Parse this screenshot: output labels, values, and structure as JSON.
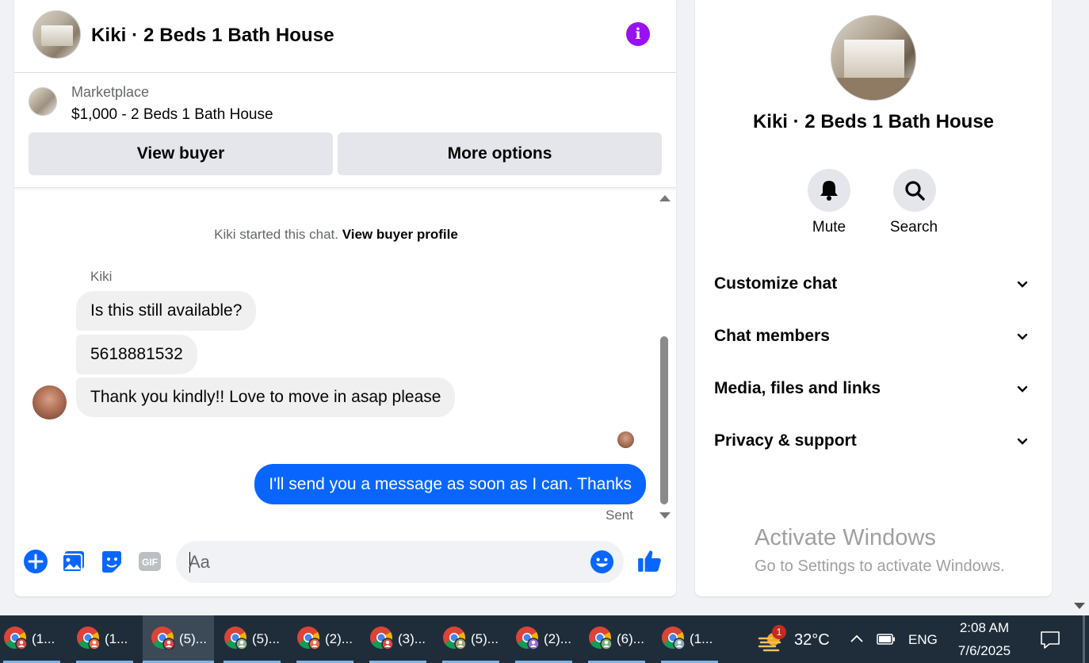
{
  "header": {
    "title": "Kiki · 2 Beds 1 Bath House"
  },
  "listing": {
    "label": "Marketplace",
    "price_title": "$1,000 - 2 Beds 1 Bath House",
    "view_buyer": "View buyer",
    "more_options": "More options"
  },
  "messages": {
    "started_text": "Kiki started this chat.",
    "started_link": "View buyer profile",
    "sender": "Kiki",
    "incoming": [
      "Is this still available?",
      "5618881532",
      "Thank you kindly!! Love to move in asap please"
    ],
    "outgoing": "I'll send you a message as soon as I can. Thanks",
    "status": "Sent"
  },
  "composer": {
    "placeholder": "Aa"
  },
  "info": {
    "name": "Kiki · 2 Beds 1 Bath House",
    "mute": "Mute",
    "search": "Search",
    "sections": [
      "Customize chat",
      "Chat members",
      "Media, files and links",
      "Privacy & support"
    ]
  },
  "watermark": {
    "title": "Activate Windows",
    "subtitle": "Go to Settings to activate Windows."
  },
  "taskbar": {
    "items": [
      "(1...",
      "(1...",
      "(5)...",
      "(5)...",
      "(2)...",
      "(3)...",
      "(5)...",
      "(2)...",
      "(6)...",
      "(1..."
    ],
    "weather_badge": "1",
    "temperature": "32°C",
    "language": "ENG",
    "time": "2:08 AM",
    "date": "7/6/2025"
  },
  "colors": {
    "accent": "#0866ff",
    "info_button": "#9b10f1",
    "taskbar": "#1f2d3a"
  }
}
